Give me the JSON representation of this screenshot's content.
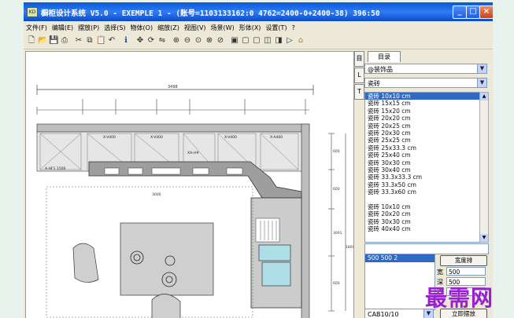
{
  "window": {
    "title": "橱柜设计系统 V5.0 - EXEMPLE 1 - (账号=1103133162:0 4762=2400-0+2400-38) 396:50",
    "app_icon_text": "KD",
    "minimize": "_",
    "maximize": "□",
    "close": "×"
  },
  "menu": [
    "文件(F)",
    "编辑(E)",
    "摆放(P)",
    "选择(S)",
    "物体(O)",
    "缩放(Z)",
    "视图(V)",
    "场景(W)",
    "形体(X)",
    "设置(T)",
    "?"
  ],
  "toolbar_icons": [
    "new-icon",
    "open-icon",
    "save-icon",
    "print-icon",
    "cut-icon",
    "copy-icon",
    "paste-icon",
    "undo-icon",
    "info-icon",
    "move-icon",
    "rotate-icon",
    "mirror-icon",
    "zoom-in-icon",
    "zoom-out-icon",
    "zoom-window-icon",
    "zoom-all-icon",
    "zoom-prev-icon",
    "box-icon",
    "view1-icon",
    "view2-icon",
    "view3-icon",
    "view4-icon",
    "play-icon",
    "light-icon"
  ],
  "drawing": {
    "overall_width": "3498",
    "labels": [
      "A-HF1 1500",
      "X-V400",
      "X-V400",
      "X-V400",
      "X-A400",
      "XA-H#"
    ],
    "dim_right": [
      "600",
      "600",
      "3001",
      "600",
      "1800"
    ],
    "dim_bottom": "3000"
  },
  "side_tabs": [
    "目",
    "L",
    "T",
    "□"
  ],
  "panel": {
    "tab_label": "目录",
    "category": "@装饰品",
    "subcategory": "瓷砖",
    "items": [
      "瓷砖 10x10 cm",
      "瓷砖 15x15 cm",
      "瓷砖 15x20 cm",
      "瓷砖 20x20 cm",
      "瓷砖 20x25 cm",
      "瓷砖 20x30 cm",
      "瓷砖 25x25 cm",
      "瓷砖 25x33.3 cm",
      "瓷砖 25x40 cm",
      "瓷砖 30x30 cm",
      "瓷砖 30x40 cm",
      "瓷砖 33.3x33.3 cm",
      "瓷砖 33.3x50 cm",
      "瓷砖 33.3x60 cm",
      "",
      "瓷砖 10x10 cm",
      "瓷砖 20x20 cm",
      "瓷砖 30x30 cm",
      "瓷砖 40x40 cm"
    ],
    "selected_index": 0,
    "size_entry": "500 500  2",
    "btn_define": "宽度排",
    "width_label": "宽",
    "width_value": "500",
    "height_label": "深",
    "height_value": "500",
    "z_label": "Z",
    "layer_value": "CAB10/10",
    "btn_bottom": "立即摆放"
  },
  "watermark": "最需网",
  "colors": {
    "title_bar": "#0a58d8",
    "selection": "#316ac5",
    "watermark": "#9a1fd0"
  }
}
